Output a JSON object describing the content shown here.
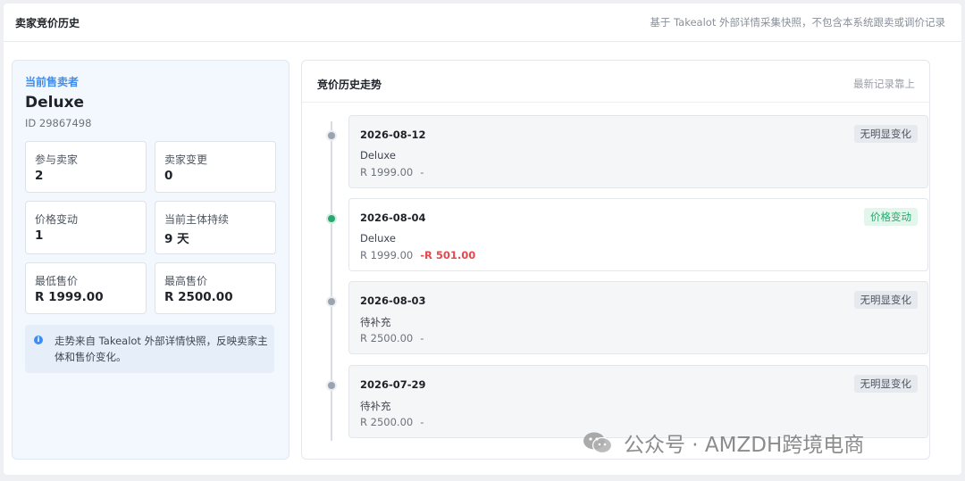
{
  "header": {
    "title": "卖家竞价历史",
    "note": "基于 Takealot 外部详情采集快照，不包含本系统跟卖或调价记录"
  },
  "current_seller": {
    "label": "当前售卖者",
    "name": "Deluxe",
    "id": "ID 29867498",
    "stats": [
      {
        "label": "参与卖家",
        "value": "2"
      },
      {
        "label": "卖家变更",
        "value": "0"
      },
      {
        "label": "价格变动",
        "value": "1"
      },
      {
        "label": "当前主体持续",
        "value": "9 天"
      },
      {
        "label": "最低售价",
        "value": "R 1999.00"
      },
      {
        "label": "最高售价",
        "value": "R 2500.00"
      }
    ],
    "info": "走势来自 Takealot 外部详情快照，反映卖家主体和售价变化。"
  },
  "trend": {
    "title": "竞价历史走势",
    "note": "最新记录靠上",
    "records": [
      {
        "date": "2026-08-12",
        "seller": "Deluxe",
        "price": "R 1999.00",
        "change": "-",
        "status": "无明显变化",
        "status_color": "#4e5560"
      },
      {
        "date": "2026-08-04",
        "seller": "Deluxe",
        "price": "R 1999.00",
        "change": "-R 501.00",
        "status": "价格变动",
        "status_color": "#28a870"
      },
      {
        "date": "2026-08-03",
        "seller": "待补充",
        "price": "R 2500.00",
        "change": "-",
        "status": "无明显变化",
        "status_color": "#4e5560"
      },
      {
        "date": "2026-07-29",
        "seller": "待补充",
        "price": "R 2500.00",
        "change": "-",
        "status": "无明显变化",
        "status_color": "#4e5560"
      }
    ]
  },
  "watermark": "公众号 · AMZDH跨境电商",
  "colors": {
    "accent": "#3d8ef0",
    "positive": "#28a870",
    "negative": "#e5484d"
  }
}
